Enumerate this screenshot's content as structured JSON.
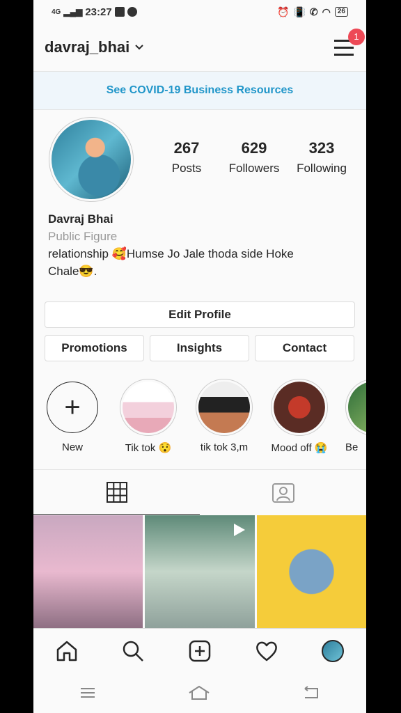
{
  "status": {
    "network": "4G",
    "time": "23:27",
    "battery": "26"
  },
  "header": {
    "username": "davraj_bhai",
    "menu_badge": "1"
  },
  "banner": {
    "covid_link": "See COVID-19 Business Resources"
  },
  "stats": [
    {
      "value": "267",
      "label": "Posts"
    },
    {
      "value": "629",
      "label": "Followers"
    },
    {
      "value": "323",
      "label": "Following"
    }
  ],
  "bio": {
    "name": "Davraj Bhai",
    "category": "Public Figure",
    "line1": "relationship 🥰Humse Jo Jale thoda side Hoke",
    "line2": "Chale😎."
  },
  "buttons": {
    "edit_profile": "Edit Profile",
    "promotions": "Promotions",
    "insights": "Insights",
    "contact": "Contact"
  },
  "highlights": [
    {
      "label": "New"
    },
    {
      "label": "Tik tok 😯"
    },
    {
      "label": "tik tok 3,m"
    },
    {
      "label": "Mood off 😭"
    },
    {
      "label": "Be"
    }
  ],
  "icons": {
    "grid_tab": "grid-icon",
    "tagged_tab": "tagged-user-icon",
    "home": "home-icon",
    "search": "search-icon",
    "add": "add-post-icon",
    "activity": "heart-icon",
    "profile": "profile-avatar-icon"
  },
  "colors": {
    "link_blue": "#2196c9",
    "badge_red": "#ed4956"
  }
}
